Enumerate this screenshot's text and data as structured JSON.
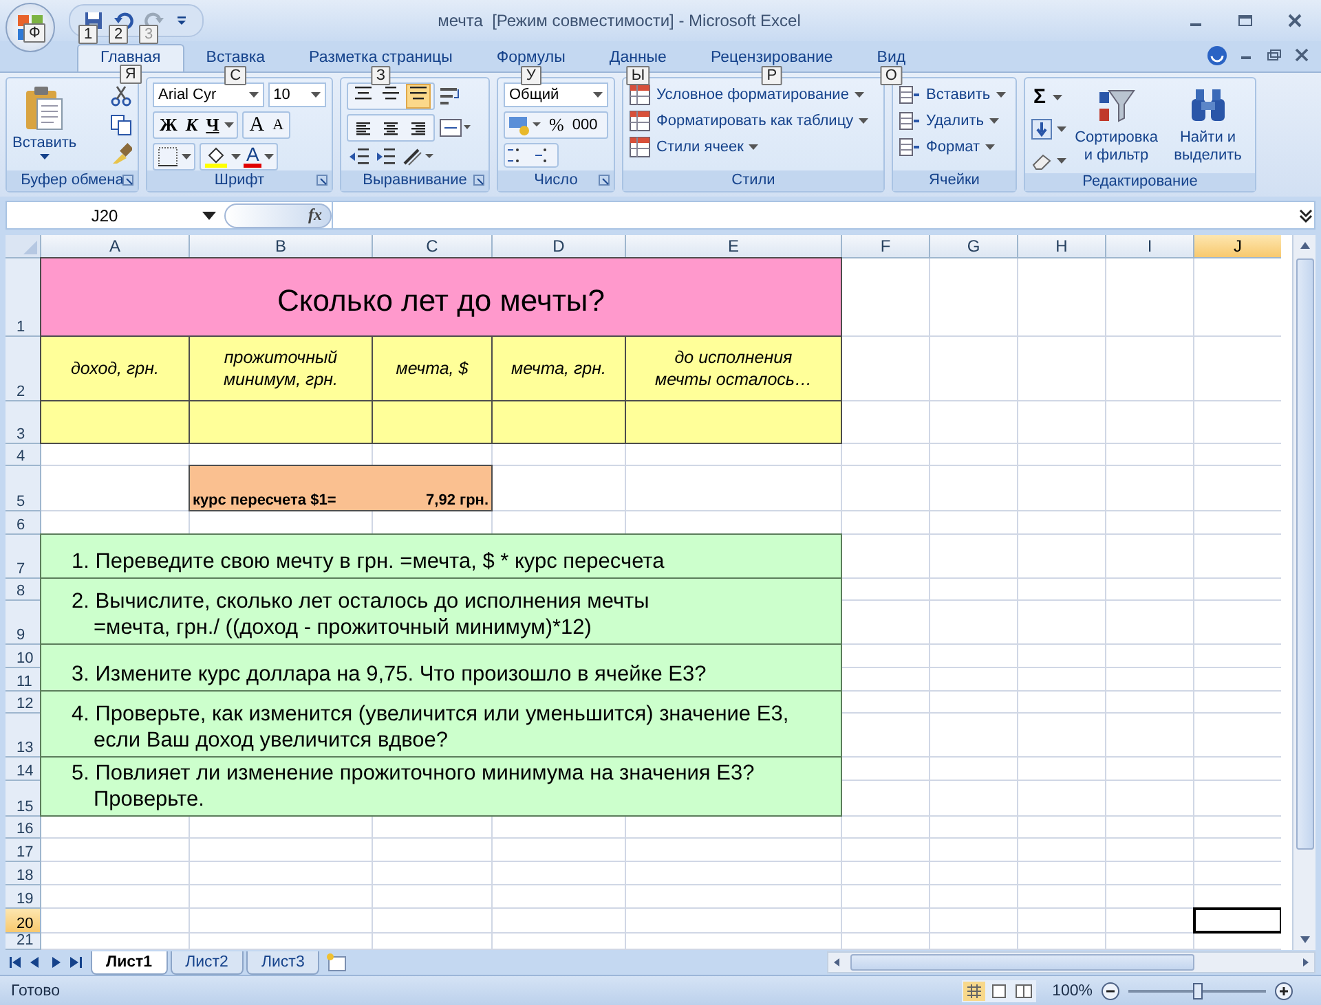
{
  "window": {
    "title": "мечта  [Режим совместимости] - Microsoft Excel"
  },
  "office_button": {
    "keytip": "Ф"
  },
  "quick_access": [
    {
      "kind": "save",
      "keytip": "1",
      "disabled": false
    },
    {
      "kind": "undo",
      "keytip": "2",
      "disabled": false
    },
    {
      "kind": "redo",
      "keytip": "3",
      "disabled": true
    }
  ],
  "tabs": [
    {
      "label": "Главная",
      "keytip": "Я",
      "selected": true
    },
    {
      "label": "Вставка",
      "keytip": "С",
      "selected": false
    },
    {
      "label": "Разметка страницы",
      "keytip": "З",
      "selected": false
    },
    {
      "label": "Формулы",
      "keytip": "У",
      "selected": false
    },
    {
      "label": "Данные",
      "keytip": "Ы",
      "selected": false
    },
    {
      "label": "Рецензирование",
      "keytip": "Р",
      "selected": false
    },
    {
      "label": "Вид",
      "keytip": "О",
      "selected": false
    }
  ],
  "ribbon": {
    "clipboard": {
      "label": "Буфер обмена",
      "paste": "Вставить"
    },
    "font": {
      "label": "Шрифт",
      "font_name": "Arial Cyr",
      "font_size": "10",
      "bold": "Ж",
      "italic": "К",
      "underline": "Ч",
      "grow": "A",
      "shrink": "A",
      "font_color": "A"
    },
    "alignment": {
      "label": "Выравнивание",
      "vertical": [
        {
          "kind": "top",
          "selected": false
        },
        {
          "kind": "middle",
          "selected": false
        },
        {
          "kind": "bottom",
          "selected": true
        }
      ],
      "horizontal": [
        {
          "kind": "left",
          "selected": false
        },
        {
          "kind": "center",
          "selected": false
        },
        {
          "kind": "right",
          "selected": false
        }
      ]
    },
    "number": {
      "label": "Число",
      "format": "Общий",
      "percent": "%",
      "thousands": "000"
    },
    "styles": {
      "label": "Стили",
      "items": [
        "Условное форматирование",
        "Форматировать как таблицу",
        "Стили ячеек"
      ]
    },
    "cells": {
      "label": "Ячейки",
      "items": [
        "Вставить",
        "Удалить",
        "Формат"
      ]
    },
    "editing": {
      "label": "Редактирование",
      "sum": "Σ",
      "sort": "Сортировка и фильтр",
      "find": "Найти и выделить"
    }
  },
  "formula_bar": {
    "name_box": "J20",
    "fx": "fx"
  },
  "sheet": {
    "columns": [
      {
        "label": "A",
        "selected": false
      },
      {
        "label": "B",
        "selected": false
      },
      {
        "label": "C",
        "selected": false
      },
      {
        "label": "D",
        "selected": false
      },
      {
        "label": "E",
        "selected": false
      },
      {
        "label": "F",
        "selected": false
      },
      {
        "label": "G",
        "selected": false
      },
      {
        "label": "H",
        "selected": false
      },
      {
        "label": "I",
        "selected": false
      },
      {
        "label": "J",
        "selected": true
      }
    ],
    "rows": [
      {
        "label": "1",
        "selected": false
      },
      {
        "label": "2",
        "selected": false
      },
      {
        "label": "3",
        "selected": false
      },
      {
        "label": "4",
        "selected": false
      },
      {
        "label": "5",
        "selected": false
      },
      {
        "label": "6",
        "selected": false
      },
      {
        "label": "7",
        "selected": false
      },
      {
        "label": "8",
        "selected": false
      },
      {
        "label": "9",
        "selected": false
      },
      {
        "label": "10",
        "selected": false
      },
      {
        "label": "11",
        "selected": false
      },
      {
        "label": "12",
        "selected": false
      },
      {
        "label": "13",
        "selected": false
      },
      {
        "label": "14",
        "selected": false
      },
      {
        "label": "15",
        "selected": false
      },
      {
        "label": "16",
        "selected": false
      },
      {
        "label": "17",
        "selected": false
      },
      {
        "label": "18",
        "selected": false
      },
      {
        "label": "19",
        "selected": false
      },
      {
        "label": "20",
        "selected": true
      },
      {
        "label": "21",
        "selected": false
      }
    ],
    "title": "Сколько лет до мечты?",
    "headers": [
      "доход, грн.",
      "прожиточный минимум, грн.",
      "мечта, $",
      "мечта, грн.",
      "до исполнения мечты осталось…"
    ],
    "rate": {
      "label": "курс пересчета $1=",
      "value": "7,92 грн."
    },
    "tasks": [
      {
        "lines": [
          "1. Переведите свою мечту в грн. =мечта, $ * курс пересчета"
        ]
      },
      {
        "lines": [
          "2. Вычислите, сколько лет осталось до исполнения мечты",
          "=мечта, грн./ ((доход - прожиточный минимум)*12)"
        ]
      },
      {
        "lines": [
          "3. Измените курс доллара на 9,75. Что произошло в ячейке Е3?"
        ]
      },
      {
        "lines": [
          "4. Проверьте, как изменится (увеличится или уменьшится) значение Е3,",
          "если Ваш доход увеличится вдвое?"
        ]
      },
      {
        "lines": [
          "5. Повлияет ли изменение прожиточного минимума на значения Е3?",
          "Проверьте."
        ]
      }
    ]
  },
  "sheet_tabs": [
    {
      "label": "Лист1",
      "selected": true
    },
    {
      "label": "Лист2",
      "selected": false
    },
    {
      "label": "Лист3",
      "selected": false
    }
  ],
  "status_bar": {
    "status": "Готово",
    "zoom": "100%",
    "zoom_slider": {
      "level": 0.5
    }
  }
}
